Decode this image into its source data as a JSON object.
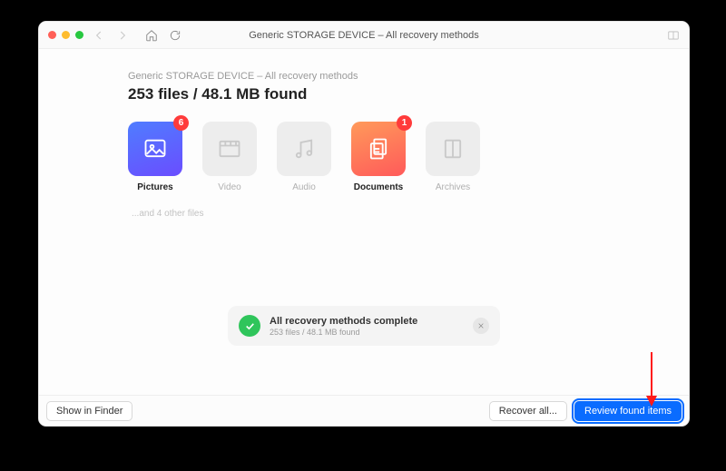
{
  "window": {
    "title": "Generic STORAGE DEVICE – All recovery methods"
  },
  "header": {
    "crumb": "Generic STORAGE DEVICE – All recovery methods",
    "headline": "253 files / 48.1 MB found"
  },
  "tiles": {
    "pictures": {
      "label": "Pictures",
      "badge": "6"
    },
    "video": {
      "label": "Video"
    },
    "audio": {
      "label": "Audio"
    },
    "documents": {
      "label": "Documents",
      "badge": "1"
    },
    "archives": {
      "label": "Archives"
    }
  },
  "other_files_note": "...and 4 other files",
  "status": {
    "title": "All recovery methods complete",
    "sub": "253 files / 48.1 MB found"
  },
  "footer": {
    "show_in_finder": "Show in Finder",
    "recover_all": "Recover all...",
    "review": "Review found items"
  },
  "colors": {
    "accent_blue": "#0a6cff",
    "badge_red": "#ff3b3b",
    "check_green": "#2fc55b"
  }
}
